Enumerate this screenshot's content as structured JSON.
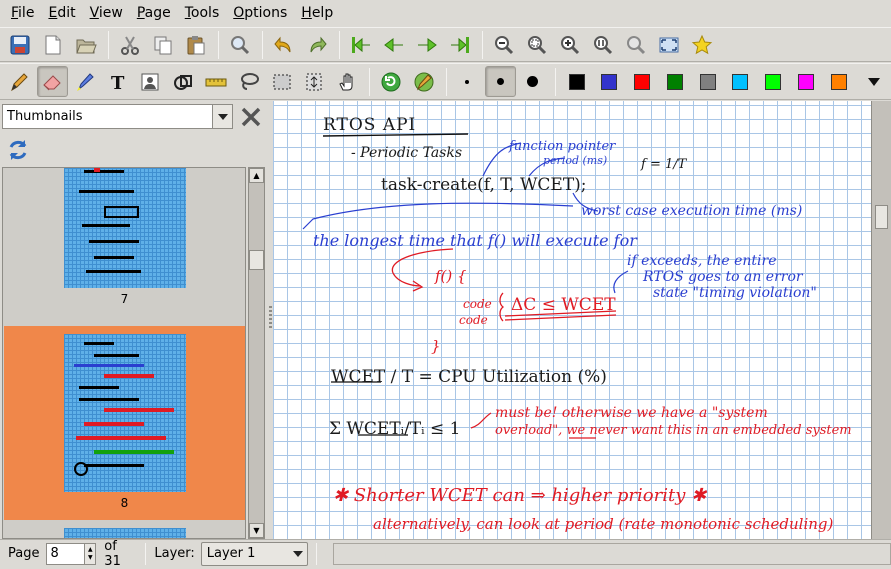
{
  "menubar": {
    "items": [
      "File",
      "Edit",
      "View",
      "Page",
      "Tools",
      "Options",
      "Help"
    ]
  },
  "toolbar_main": {
    "icons": [
      "save-icon",
      "new-icon",
      "open-icon",
      "cut-icon",
      "copy-icon",
      "paste-icon",
      "find-icon",
      "undo-icon",
      "redo-icon",
      "first-page-icon",
      "previous-page-icon",
      "next-page-icon",
      "last-page-icon",
      "zoom-out-icon",
      "zoom-fit-icon",
      "zoom-in-icon",
      "zoom-100-icon",
      "zoom-width-icon",
      "fullscreen-icon",
      "star-icon"
    ]
  },
  "toolbar_pen": {
    "tools": [
      "pen-icon",
      "eraser-icon",
      "highlighter-icon",
      "text-icon",
      "image-icon",
      "shape-recognizer-icon",
      "ruler-icon",
      "lasso-icon",
      "rect-select-icon",
      "vertical-space-icon",
      "hand-icon",
      "default-pen-icon",
      "pen-settings-icon"
    ],
    "active_tool": "eraser-icon",
    "thickness": [
      "fine",
      "medium",
      "thick"
    ],
    "active_thickness": "medium",
    "colors": [
      "#000000",
      "#3333cc",
      "#ff0000",
      "#008000",
      "#808080",
      "#00c0ff",
      "#00ff00",
      "#ff00ff",
      "#ff8000"
    ]
  },
  "sidebar": {
    "title": "Thumbnails",
    "pages": [
      {
        "label": "7",
        "selected": false
      },
      {
        "label": "8",
        "selected": true
      },
      {
        "label": "",
        "selected": false
      }
    ]
  },
  "canvas": {
    "lines": {
      "title": "RTOS   API",
      "periodic": "- Periodic Tasks",
      "function_pointer": "function pointer",
      "period": "period (ms)",
      "fraction": "f = 1/T",
      "task_create": "task-create(f, T, WCET);",
      "worst_case": "worst case execution time (ms)",
      "longest": "the longest time that f() will execute for",
      "if_exceeds_1": "if exceeds, the entire",
      "if_exceeds_2": "RTOS goes to an error",
      "if_exceeds_3": "state \"timing violation\"",
      "f_open": "f() {",
      "code1": "code",
      "code2": "code",
      "delta": "ΔC ≤ WCET",
      "brace_close": "}",
      "cpu_util": "WCET / T  = CPU Utilization (%)",
      "sum": "Σ WCETᵢ/Tᵢ ≤ 1",
      "must_be_1": "must be! otherwise we have a \"system",
      "must_be_2": "overload\", we never want this in an embedded system",
      "shorter": "✱ Shorter  WCET  can ⇒ higher priority ✱",
      "alternatively": "alternatively, can look at period (rate monotonic scheduling)"
    }
  },
  "statusbar": {
    "page_label": "Page",
    "page_value": "8",
    "of_label": "of 31",
    "layer_label": "Layer:",
    "layer_value": "Layer 1"
  }
}
